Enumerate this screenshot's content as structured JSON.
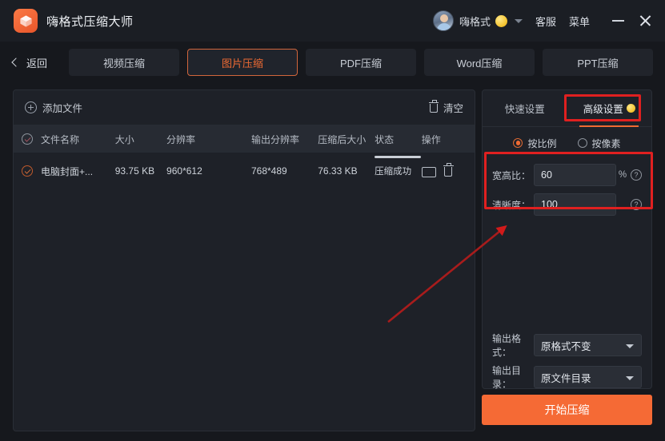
{
  "window": {
    "app_title": "嗨格式压缩大师",
    "logo_icon": "cube-logo-icon",
    "user": {
      "avatar_icon": "user-avatar",
      "name": "嗨格式",
      "vip_badge_icon": "vip-coin-icon",
      "dropdown_icon": "chevron-down-icon"
    },
    "links": [
      {
        "label": "客服",
        "name": "customer-service-link"
      },
      {
        "label": "菜单",
        "name": "menu-link"
      }
    ],
    "controls": {
      "minimize_icon": "minimize-icon",
      "close_icon": "close-icon"
    }
  },
  "nav": {
    "back_label": "返回",
    "back_icon": "chevron-left-icon",
    "tabs": [
      {
        "label": "视频压缩",
        "active": false
      },
      {
        "label": "图片压缩",
        "active": true
      },
      {
        "label": "PDF压缩",
        "active": false
      },
      {
        "label": "Word压缩",
        "active": false
      },
      {
        "label": "PPT压缩",
        "active": false
      }
    ]
  },
  "file_panel": {
    "add_file_label": "添加文件",
    "add_file_icon": "plus-circle-icon",
    "clear_label": "清空",
    "clear_icon": "trash-icon",
    "columns": [
      "文件名称",
      "大小",
      "分辨率",
      "输出分辨率",
      "压缩后大小",
      "状态",
      "操作"
    ],
    "rows": [
      {
        "checked": true,
        "name": "电脑封面+...",
        "size": "93.75 KB",
        "resolution": "960*612",
        "output_resolution": "768*489",
        "compressed_size": "76.33 KB",
        "status": "压缩成功",
        "progress": 100,
        "actions": {
          "open_folder_icon": "folder-open-icon",
          "delete_icon": "trash-icon"
        }
      }
    ]
  },
  "settings": {
    "tabs": [
      {
        "label": "快速设置",
        "active": false,
        "vip": false
      },
      {
        "label": "高级设置",
        "active": true,
        "vip": true
      }
    ],
    "mode_options": [
      {
        "label": "按比例",
        "selected": true
      },
      {
        "label": "按像素",
        "selected": false
      }
    ],
    "fields": [
      {
        "label": "宽高比：",
        "value": "60",
        "unit": "%",
        "help_icon": "help-icon"
      },
      {
        "label": "清晰度：",
        "value": "100",
        "unit": "",
        "help_icon": "help-icon"
      }
    ],
    "selects": [
      {
        "label": "输出格式：",
        "value": "原格式不变",
        "caret_icon": "chevron-down-icon"
      },
      {
        "label": "输出目录：",
        "value": "原文件目录",
        "caret_icon": "chevron-down-icon"
      }
    ],
    "start_button": "开始压缩"
  },
  "annotations": {
    "highlight_color": "#e02020",
    "boxes": [
      "advanced-settings-tab",
      "ratio-and-clarity-fields"
    ],
    "arrow": "points-to-settings-fields"
  }
}
